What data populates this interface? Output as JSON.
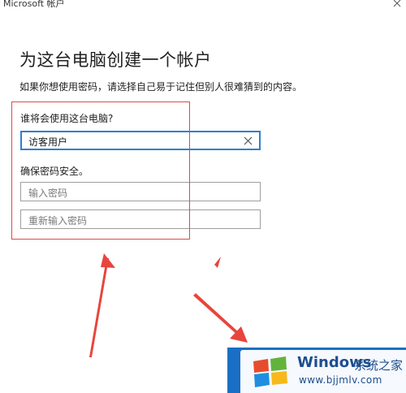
{
  "window": {
    "title": "Microsoft 帐户"
  },
  "page": {
    "heading": "为这台电脑创建一个帐户",
    "description": "如果你想使用密码，请选择自己易于记住但别人很难猜到的内容。"
  },
  "form": {
    "who_label": "谁将会使用这台电脑?",
    "username_value": "访客用户",
    "security_label": "确保密码安全。",
    "password_placeholder": "输入密码",
    "confirm_placeholder": "重新输入密码"
  },
  "watermark": {
    "brand": "Windows",
    "cn_text": "系统之家",
    "url": "www.bjjmlv.com"
  },
  "colors": {
    "accent": "#2f7fd1",
    "annotation": "#e04848",
    "button": "#1a6fc4"
  },
  "icons": {
    "clear": "close-icon",
    "arrow": "arrow-icon",
    "logo": "windows-logo"
  }
}
